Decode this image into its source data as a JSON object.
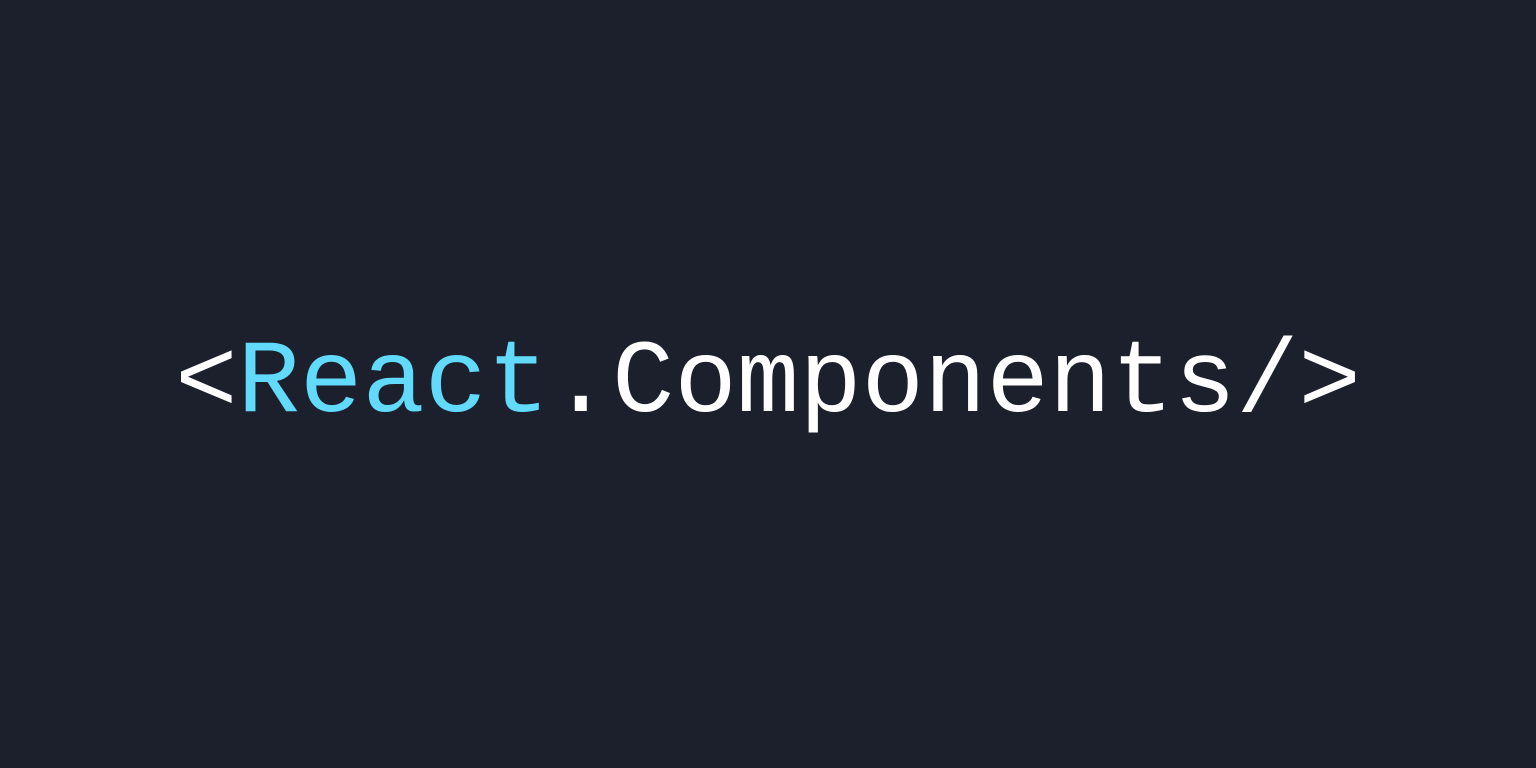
{
  "logo": {
    "open_bracket": "<",
    "keyword": "React",
    "dot": ".",
    "identifier": "Components",
    "close_bracket": "/>"
  },
  "colors": {
    "background": "#1c202c",
    "accent": "#61dafb",
    "text": "#ffffff"
  }
}
